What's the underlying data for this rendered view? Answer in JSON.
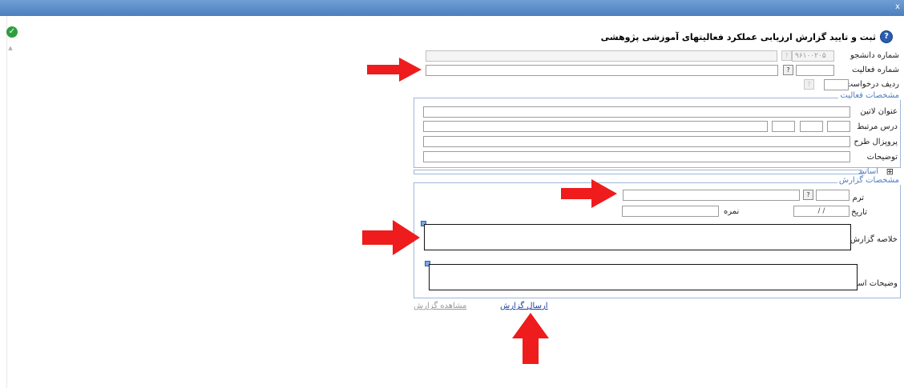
{
  "page_title": "ثبت و تایید گزارش ارزیابی عملکرد فعالیتهای آموزشی پژوهشی",
  "fields": {
    "student_no_label": "شماره دانشجو",
    "student_no_value": "۹۶۱۰۰۲۰۵",
    "activity_no_label": "شماره فعالیت",
    "request_row_label": "ردیف درخواست"
  },
  "activity_section": {
    "legend": "مشخصات فعالیت",
    "latin_title_label": "عنوان لاتین",
    "related_course_label": "درس مرتبط",
    "proposal_label": "پروپزال طرح",
    "description_label": "توضیحات"
  },
  "professors_section": {
    "legend": "اساتید",
    "toggle": "⊞"
  },
  "report_section": {
    "legend": "مشخصات گزارش",
    "term_label": "ترم",
    "date_label": "تاریخ",
    "date_value": "/     /",
    "grade_label": "نمره",
    "summary_label": "خلاصه گزارش",
    "professor_notes_label": "وضیحات استاد"
  },
  "actions": {
    "send_report": "ارسال گزارش",
    "view_report": "مشاهده گزارش"
  },
  "icons": {
    "help_glyph": "?",
    "lookup_glyph": "?",
    "ok_glyph": "✓",
    "close_glyph": "x",
    "scroll_glyph": "▲"
  },
  "colors": {
    "arrow": "#ee1c1c",
    "titlebar": "#5b8ccb",
    "legend_text": "#4c7cc4"
  }
}
